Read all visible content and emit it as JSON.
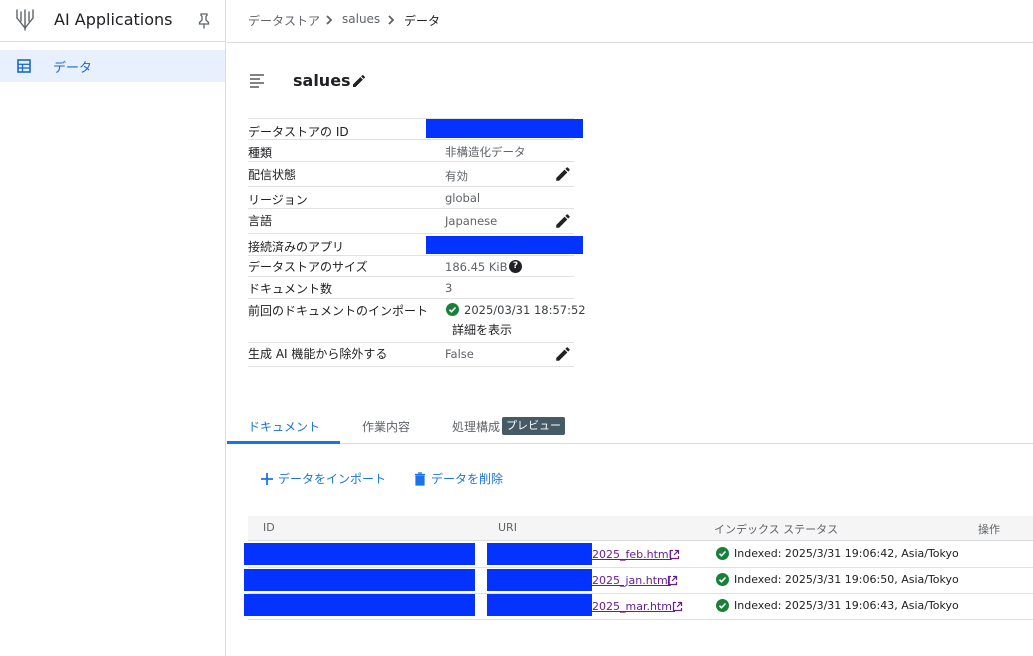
{
  "app": {
    "title": "AI Applications"
  },
  "sidebar": {
    "items": [
      {
        "label": "データ"
      }
    ]
  },
  "breadcrumb": [
    "データストア",
    "salues",
    "データ"
  ],
  "datastore": {
    "name": "salues",
    "rows": [
      {
        "label": "データストアの ID",
        "value": ""
      },
      {
        "label": "種類",
        "value": "非構造化データ"
      },
      {
        "label": "配信状態",
        "value": "有効"
      },
      {
        "label": "リージョン",
        "value": "global"
      },
      {
        "label": "言語",
        "value": "Japanese"
      },
      {
        "label": "接続済みのアプリ",
        "value": ""
      },
      {
        "label": "データストアのサイズ",
        "value": "186.45 KiB"
      },
      {
        "label": "ドキュメント数",
        "value": "3"
      },
      {
        "label": "前回のドキュメントのインポート",
        "value": "2025/03/31 18:57:52",
        "link": "詳細を表示"
      },
      {
        "label": "生成 AI 機能から除外する",
        "value": "False"
      }
    ]
  },
  "tabs": [
    {
      "label": "ドキュメント"
    },
    {
      "label": "作業内容"
    },
    {
      "label": "処理構成",
      "badge": "プレビュー"
    }
  ],
  "actions": {
    "import": "データをインポート",
    "delete": "データを削除"
  },
  "table": {
    "headers": [
      "ID",
      "URI",
      "インデックス ステータス",
      "操作"
    ],
    "rows": [
      {
        "uri": "2025_feb.html",
        "status": "Indexed: 2025/3/31 19:06:42, Asia/Tokyo"
      },
      {
        "uri": "2025_jan.html",
        "status": "Indexed: 2025/3/31 19:06:50, Asia/Tokyo"
      },
      {
        "uri": "2025_mar.html",
        "status": "Indexed: 2025/3/31 19:06:43, Asia/Tokyo"
      }
    ]
  },
  "colors": {
    "accent": "#1a73e8",
    "redaction": "#0433ff",
    "success": "#188038",
    "visited_link": "#6a1b9a"
  }
}
